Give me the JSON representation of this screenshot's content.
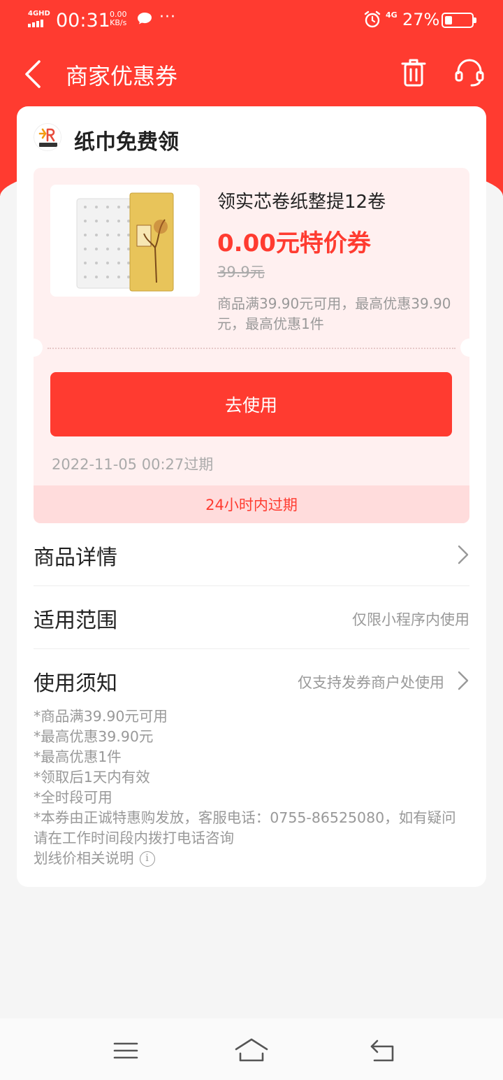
{
  "status_bar": {
    "network": "4GHD",
    "time": "00:31",
    "speed_value": "0.00",
    "speed_unit": "KB/s",
    "more": "···",
    "network_right": "4G",
    "battery_percent": "27%",
    "battery_level": 0.27
  },
  "nav": {
    "title": "商家优惠券"
  },
  "shop": {
    "name": "纸巾免费领"
  },
  "coupon": {
    "product_title": "领实芯卷纸整提12卷",
    "price_label": "0.00元特价券",
    "original_price": "39.9元",
    "description": "商品满39.90元可用，最高优惠39.90元，最高优惠1件",
    "use_button": "去使用",
    "expire_time": "2022-11-05 00:27过期",
    "expire_notice": "24小时内过期"
  },
  "rows": {
    "details_label": "商品详情",
    "scope_label": "适用范围",
    "scope_value": "仅限小程序内使用",
    "notice_label": "使用须知",
    "notice_value": "仅支持发券商户处使用"
  },
  "notes": [
    "*商品满39.90元可用",
    "*最高优惠39.90元",
    "*最高优惠1件",
    "*领取后1天内有效",
    "*全时段可用",
    "*本券由正诚特惠购发放，客服电话：0755-86525080，如有疑问请在工作时间段内拨打电话咨询"
  ],
  "strike_price_note": "划线价相关说明",
  "icons": {
    "back": "chevron-left-icon",
    "trash": "trash-icon",
    "service": "headset-icon",
    "arrow": "chevron-right-icon",
    "info": "info-icon"
  },
  "colors": {
    "primary": "#ff3b30",
    "coupon_bg": "#fff0f0",
    "expire_bar_bg": "#ffdcdc"
  }
}
